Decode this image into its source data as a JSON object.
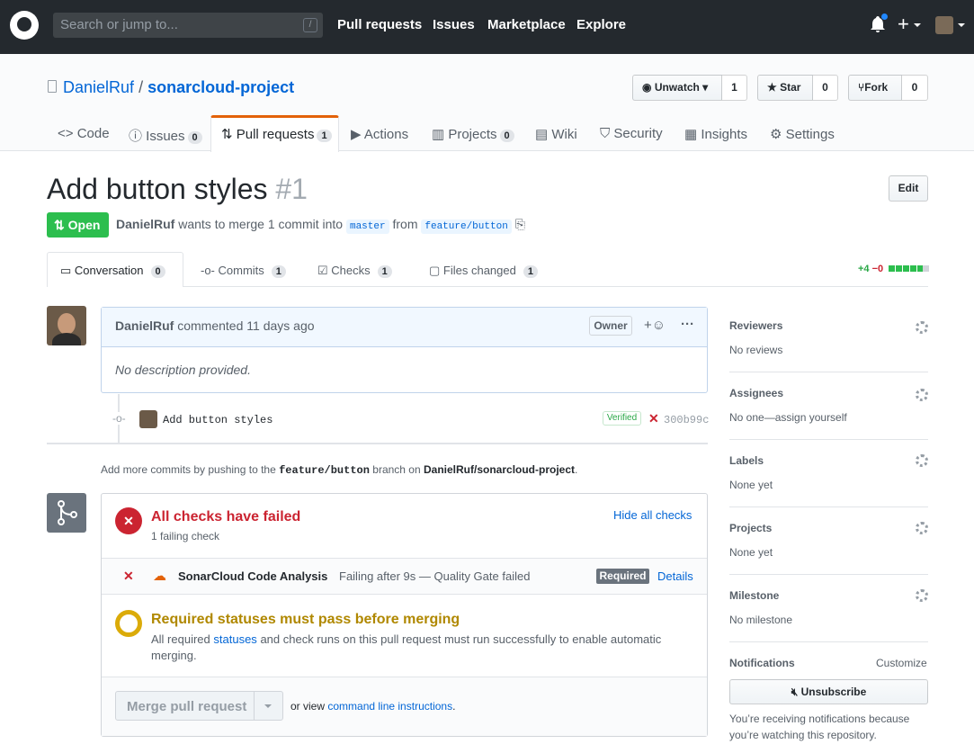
{
  "header": {
    "search_placeholder": "Search or jump to...",
    "slash_key": "/",
    "nav": [
      "Pull requests",
      "Issues",
      "Marketplace",
      "Explore"
    ]
  },
  "repo": {
    "owner": "DanielRuf",
    "sep": "/",
    "name": "sonarcloud-project",
    "unwatch": "Unwatch",
    "watch_count": "1",
    "star": "Star",
    "star_count": "0",
    "fork": "Fork",
    "fork_count": "0",
    "tabs": [
      {
        "label": "Code"
      },
      {
        "label": "Issues",
        "count": "0"
      },
      {
        "label": "Pull requests",
        "count": "1"
      },
      {
        "label": "Actions"
      },
      {
        "label": "Projects",
        "count": "0"
      },
      {
        "label": "Wiki"
      },
      {
        "label": "Security"
      },
      {
        "label": "Insights"
      },
      {
        "label": "Settings"
      }
    ]
  },
  "pr": {
    "title": "Add button styles",
    "number": "#1",
    "edit": "Edit",
    "state": "Open",
    "author": "DanielRuf",
    "merge_text1": "wants to merge 1 commit into",
    "base": "master",
    "from": "from",
    "head": "feature/button",
    "tabs": [
      {
        "label": "Conversation",
        "count": "0"
      },
      {
        "label": "Commits",
        "count": "1"
      },
      {
        "label": "Checks",
        "count": "1"
      },
      {
        "label": "Files changed",
        "count": "1"
      }
    ],
    "additions": "+4",
    "deletions": "−0"
  },
  "comment": {
    "author": "DanielRuf",
    "time": "commented 11 days ago",
    "role": "Owner",
    "reaction": "+☺",
    "more": "···",
    "body": "No description provided."
  },
  "commit": {
    "message": "Add button styles",
    "verified": "Verified",
    "sha": "300b99c"
  },
  "hint": {
    "prefix": "Add more commits by pushing to the",
    "branch": "feature/button",
    "mid": "branch on",
    "repo": "DanielRuf/sonarcloud-project",
    "end": "."
  },
  "checks": {
    "title": "All checks have failed",
    "subtitle": "1 failing check",
    "hide": "Hide all checks",
    "name": "SonarCloud Code Analysis",
    "status": "Failing after 9s — Quality Gate failed",
    "required": "Required",
    "details": "Details",
    "req_title": "Required statuses must pass before merging",
    "req_text1": "All required",
    "req_link": "statuses",
    "req_text2": "and check runs on this pull request must run successfully to enable automatic",
    "req_text3": "merging.",
    "merge_button": "Merge pull request",
    "or_view": "or view",
    "cli": "command line instructions",
    "dot": "."
  },
  "sidebar": {
    "reviewers": "Reviewers",
    "reviewers_val": "No reviews",
    "assignees": "Assignees",
    "assignees_val": "No one—assign yourself",
    "labels": "Labels",
    "labels_val": "None yet",
    "projects": "Projects",
    "projects_val": "None yet",
    "milestone": "Milestone",
    "milestone_val": "No milestone",
    "notifications": "Notifications",
    "customize": "Customize",
    "unsubscribe": "Unsubscribe",
    "notif_text1": "You’re receiving notifications because",
    "notif_text2": "you’re watching this repository."
  },
  "colors": {
    "header": "#24292e",
    "link": "#0366d6",
    "open": "#2cbe4e",
    "fail": "#cb2431",
    "pending": "#dbab09",
    "tab_accent": "#e36209"
  }
}
